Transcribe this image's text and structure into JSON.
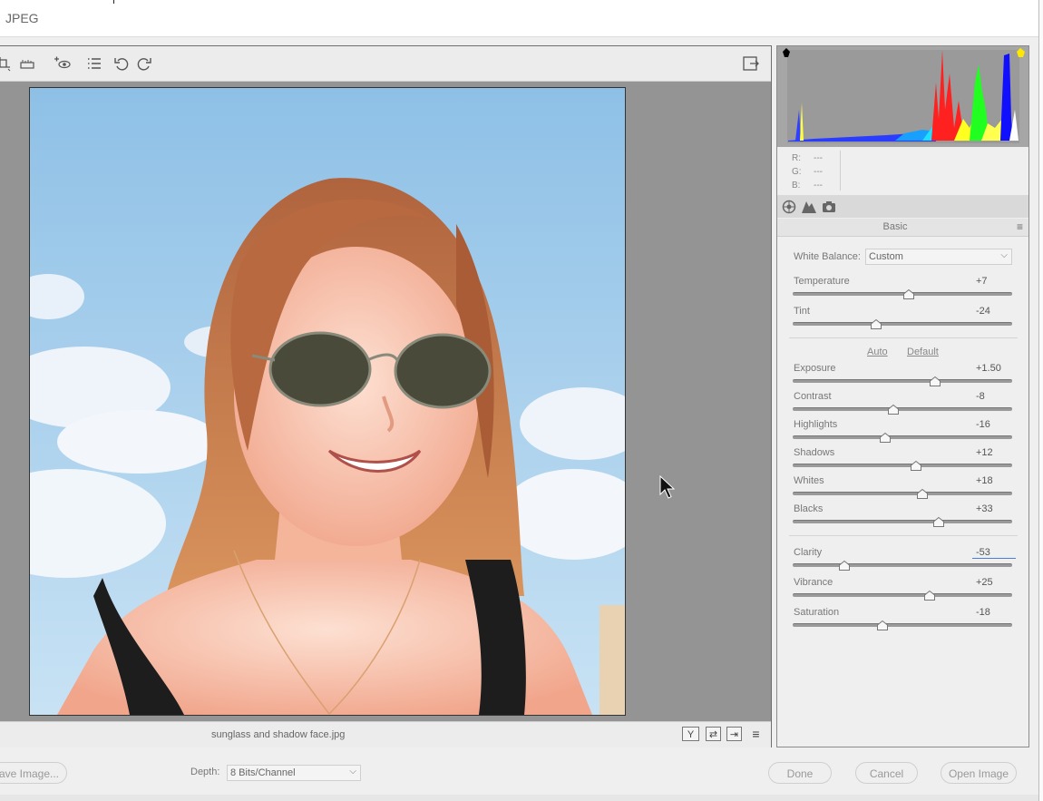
{
  "window": {
    "title": "JPEG"
  },
  "toolbar": {
    "icons": [
      "crop-icon",
      "straighten-icon",
      "red-eye-icon",
      "presets-list-icon",
      "rotate-left-icon",
      "rotate-right-icon",
      "fullscreen-toggle-icon"
    ]
  },
  "preview": {
    "filename": "sunglass and shadow face.jpg",
    "view_icons": [
      "before-after-icon",
      "swap-icon",
      "copy-settings-icon",
      "preferences-icon"
    ],
    "view_glyphs": [
      "Y",
      "⇄",
      "⇥",
      "≡"
    ]
  },
  "histogram": {
    "rgb": [
      {
        "label": "R:",
        "value": "---"
      },
      {
        "label": "G:",
        "value": "---"
      },
      {
        "label": "B:",
        "value": "---"
      }
    ]
  },
  "panel": {
    "tabs": [
      "basic-tab",
      "tone-curve-tab",
      "camera-calibration-tab"
    ],
    "section_title": "Basic",
    "white_balance": {
      "label": "White Balance:",
      "value": "Custom"
    },
    "auto_label": "Auto",
    "default_label": "Default",
    "sliders": [
      {
        "key": "temperature",
        "label": "Temperature",
        "value": "+7",
        "pos": 0.53
      },
      {
        "key": "tint",
        "label": "Tint",
        "value": "-24",
        "pos": 0.38
      },
      {
        "key": "exposure",
        "label": "Exposure",
        "value": "+1.50",
        "pos": 0.65
      },
      {
        "key": "contrast",
        "label": "Contrast",
        "value": "-8",
        "pos": 0.46
      },
      {
        "key": "highlights",
        "label": "Highlights",
        "value": "-16",
        "pos": 0.42
      },
      {
        "key": "shadows",
        "label": "Shadows",
        "value": "+12",
        "pos": 0.56
      },
      {
        "key": "whites",
        "label": "Whites",
        "value": "+18",
        "pos": 0.59
      },
      {
        "key": "blacks",
        "label": "Blacks",
        "value": "+33",
        "pos": 0.665
      },
      {
        "key": "clarity",
        "label": "Clarity",
        "value": "-53",
        "pos": 0.235
      },
      {
        "key": "vibrance",
        "label": "Vibrance",
        "value": "+25",
        "pos": 0.625
      },
      {
        "key": "saturation",
        "label": "Saturation",
        "value": "-18",
        "pos": 0.41
      }
    ]
  },
  "footer": {
    "save_image": "ave Image...",
    "depth_label": "Depth:",
    "depth_value": "8 Bits/Channel",
    "done": "Done",
    "cancel": "Cancel",
    "open_image": "Open Image"
  }
}
